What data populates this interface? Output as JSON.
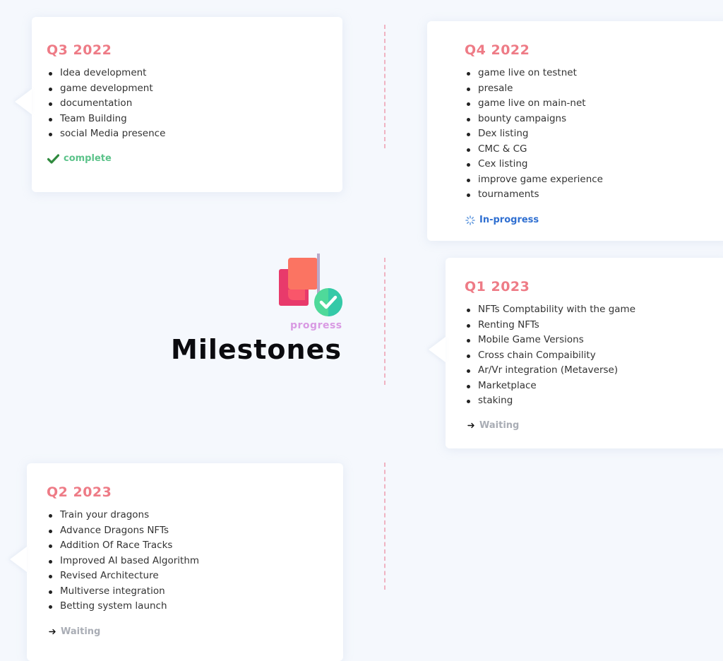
{
  "hero": {
    "logo_icon": "flag-check-icon",
    "logo_caption": "progress",
    "title": "Milestones"
  },
  "colors": {
    "background": "#f5f8fd",
    "card": "#ffffff",
    "title_accent": "#ee7b86",
    "timeline_line": "#f0a3b4",
    "complete": "#5cc38a",
    "in_progress": "#2f6fd1",
    "waiting": "#a9adb5"
  },
  "milestones": [
    {
      "quarter": "Q3 2022",
      "items": [
        "Idea development",
        "game development",
        "documentation",
        "Team Building",
        "social Media presence"
      ],
      "status": {
        "label": "complete",
        "icon": "checkmark-icon"
      }
    },
    {
      "quarter": "Q4 2022",
      "items": [
        "game live on testnet",
        "presale",
        "game live on main-net",
        "bounty campaigns",
        "Dex listing",
        "CMC & CG",
        "Cex listing",
        "improve game experience",
        "tournaments"
      ],
      "status": {
        "label": "In-progress",
        "icon": "spinner-icon"
      }
    },
    {
      "quarter": "Q1 2023",
      "items": [
        "NFTs Comptability with the game",
        "Renting NFTs",
        "Mobile Game Versions",
        "Cross chain Compaibility",
        "Ar/Vr integration (Metaverse)",
        "Marketplace",
        "staking"
      ],
      "status": {
        "label": "Waiting",
        "icon": "arrow-right-icon"
      }
    },
    {
      "quarter": "Q2 2023",
      "items": [
        "Train your dragons",
        "Advance Dragons NFTs",
        "Addition Of Race Tracks",
        "Improved AI based Algorithm",
        "Revised Architecture",
        "Multiverse integration",
        "Betting system launch"
      ],
      "status": {
        "label": "Waiting",
        "icon": "arrow-right-icon"
      }
    }
  ]
}
